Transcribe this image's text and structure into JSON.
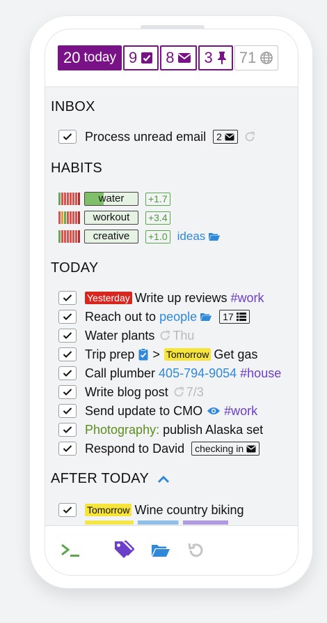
{
  "counters": {
    "today_count": "20",
    "today_label": "today",
    "tasks_count": "9",
    "mail_count": "8",
    "pinned_count": "3",
    "world_count": "71"
  },
  "sections": {
    "inbox": "INBOX",
    "habits": "HABITS",
    "today": "TODAY",
    "after_today": "AFTER TODAY"
  },
  "inbox": {
    "item_text": "Process unread email",
    "badge_count": "2"
  },
  "habits": [
    {
      "name": "water",
      "delta": "+1.7",
      "progress": 0.35
    },
    {
      "name": "workout",
      "delta": "+3.4",
      "progress": 0.0
    },
    {
      "name": "creative",
      "delta": "+1.0",
      "progress": 0.0
    }
  ],
  "habits_extra_link": "ideas",
  "today_items": {
    "i1_badge": "Yesterday",
    "i1_text": "Write up reviews",
    "i1_tag": "#work",
    "i2_text": "Reach out to",
    "i2_link": "people",
    "i2_count": "17",
    "i3_text": "Water plants",
    "i3_day": "Thu",
    "i4_text": "Trip prep",
    "i4_gt": ">",
    "i4_badge": "Tomorrow",
    "i4_text2": "Get gas",
    "i5_text": "Call plumber",
    "i5_phone": "405-794-9054",
    "i5_tag": "#house",
    "i6_text": "Write blog post",
    "i6_date": "7/3",
    "i7_text": "Send update to CMO",
    "i7_tag": "#work",
    "i8_prefix": "Photography:",
    "i8_text": "publish Alaska set",
    "i9_text": "Respond to David",
    "i9_badge": "checking in"
  },
  "after_items": {
    "a1_badge": "Tomorrow",
    "a1_text": "Wine country biking"
  },
  "colors": {
    "accent_purple": "#7a1287",
    "tag_purple": "#6b3fc9",
    "link_blue": "#2f88d8",
    "green": "#5b8d1e",
    "yesterday_red": "#d7261e",
    "tomorrow_yellow": "#f6e43a"
  },
  "icons": [
    "check-square-icon",
    "envelope-icon",
    "pin-icon",
    "globe-icon",
    "redo-icon",
    "folder-icon",
    "list-icon",
    "clipboard-check-icon",
    "eye-icon",
    "chevron-up-icon",
    "terminal-icon",
    "tags-icon",
    "folder-open-icon",
    "undo-icon"
  ]
}
